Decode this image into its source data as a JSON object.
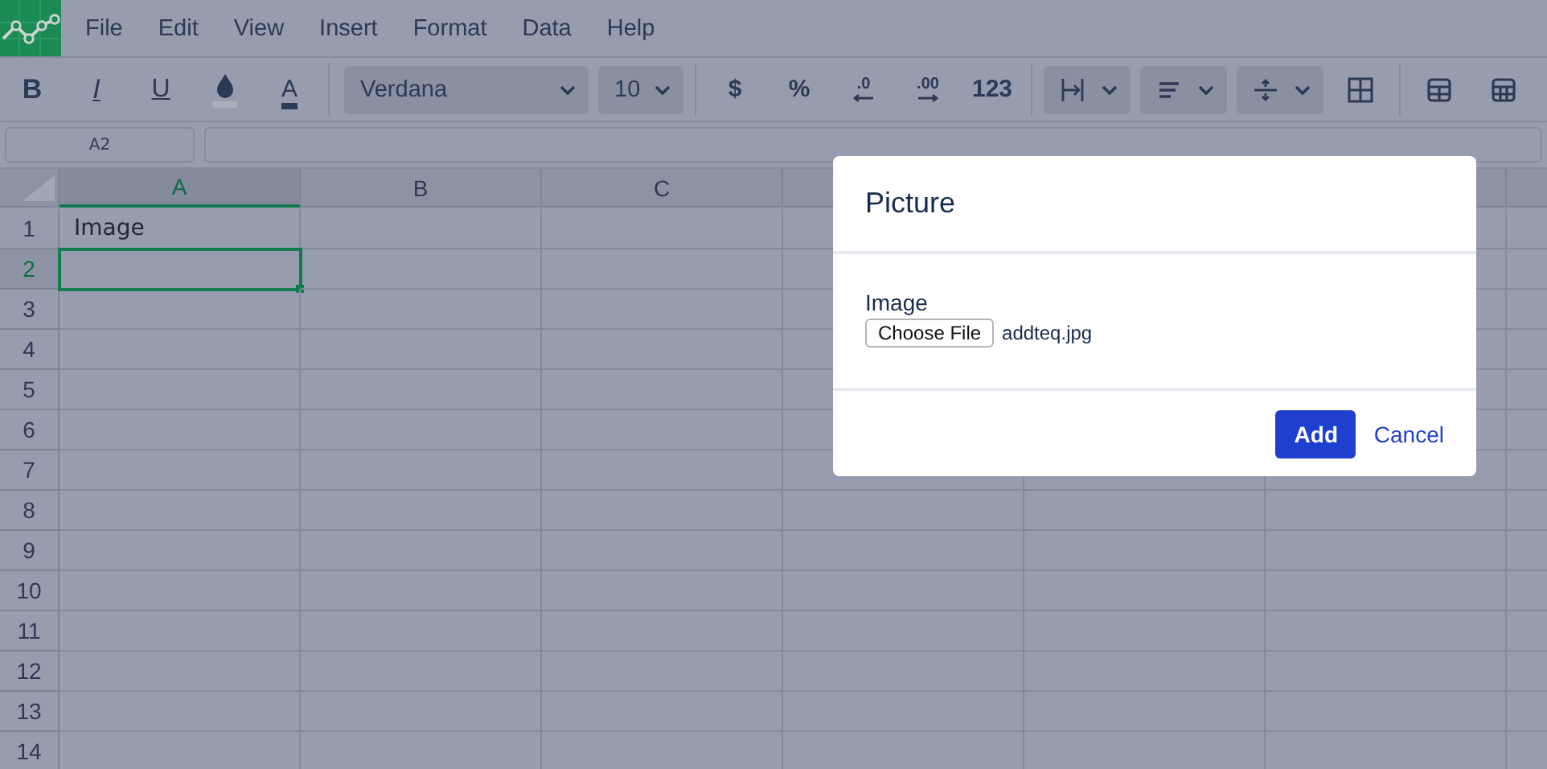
{
  "menu": [
    "File",
    "Edit",
    "View",
    "Insert",
    "Format",
    "Data",
    "Help"
  ],
  "toolbar": [
    [
      {
        "kind": "bold",
        "label": "B"
      },
      {
        "kind": "italic",
        "label": "I"
      },
      {
        "kind": "underline",
        "label": "U"
      },
      {
        "kind": "fill"
      },
      {
        "kind": "color",
        "label": "A"
      }
    ],
    [
      {
        "kind": "font",
        "label": "Verdana"
      },
      {
        "kind": "size",
        "label": "10"
      }
    ],
    [
      {
        "kind": "glyph",
        "label": "$"
      },
      {
        "kind": "glyph",
        "label": "%"
      },
      {
        "kind": "less",
        "label": ".0"
      },
      {
        "kind": "more",
        "label": ".00"
      },
      {
        "kind": "glyph",
        "label": "123"
      }
    ],
    [
      {
        "kind": "halign"
      },
      {
        "kind": "align"
      },
      {
        "kind": "valign"
      },
      {
        "kind": "merge"
      }
    ],
    [
      {
        "kind": "table"
      },
      {
        "kind": "grid"
      }
    ]
  ],
  "name_box": "A2",
  "columns": [
    {
      "label": "A",
      "selected": true
    },
    {
      "label": "B",
      "selected": false
    },
    {
      "label": "C",
      "selected": false
    }
  ],
  "rows": [
    {
      "label": "1",
      "selected": false,
      "cells": [
        "Image"
      ]
    },
    {
      "label": "2",
      "selected": true
    },
    {
      "label": "3",
      "selected": false
    },
    {
      "label": "4",
      "selected": false
    },
    {
      "label": "5",
      "selected": false
    },
    {
      "label": "6",
      "selected": false
    },
    {
      "label": "7",
      "selected": false
    },
    {
      "label": "8",
      "selected": false
    },
    {
      "label": "9",
      "selected": false
    },
    {
      "label": "10",
      "selected": false
    },
    {
      "label": "11",
      "selected": false
    },
    {
      "label": "12",
      "selected": false
    },
    {
      "label": "13",
      "selected": false
    },
    {
      "label": "14",
      "selected": false
    }
  ],
  "dialog": {
    "title": "Picture",
    "field_label": "Image",
    "file_button": "Choose File",
    "file_name": "addteq.jpg",
    "buttons": [
      "Add",
      "Cancel"
    ]
  }
}
